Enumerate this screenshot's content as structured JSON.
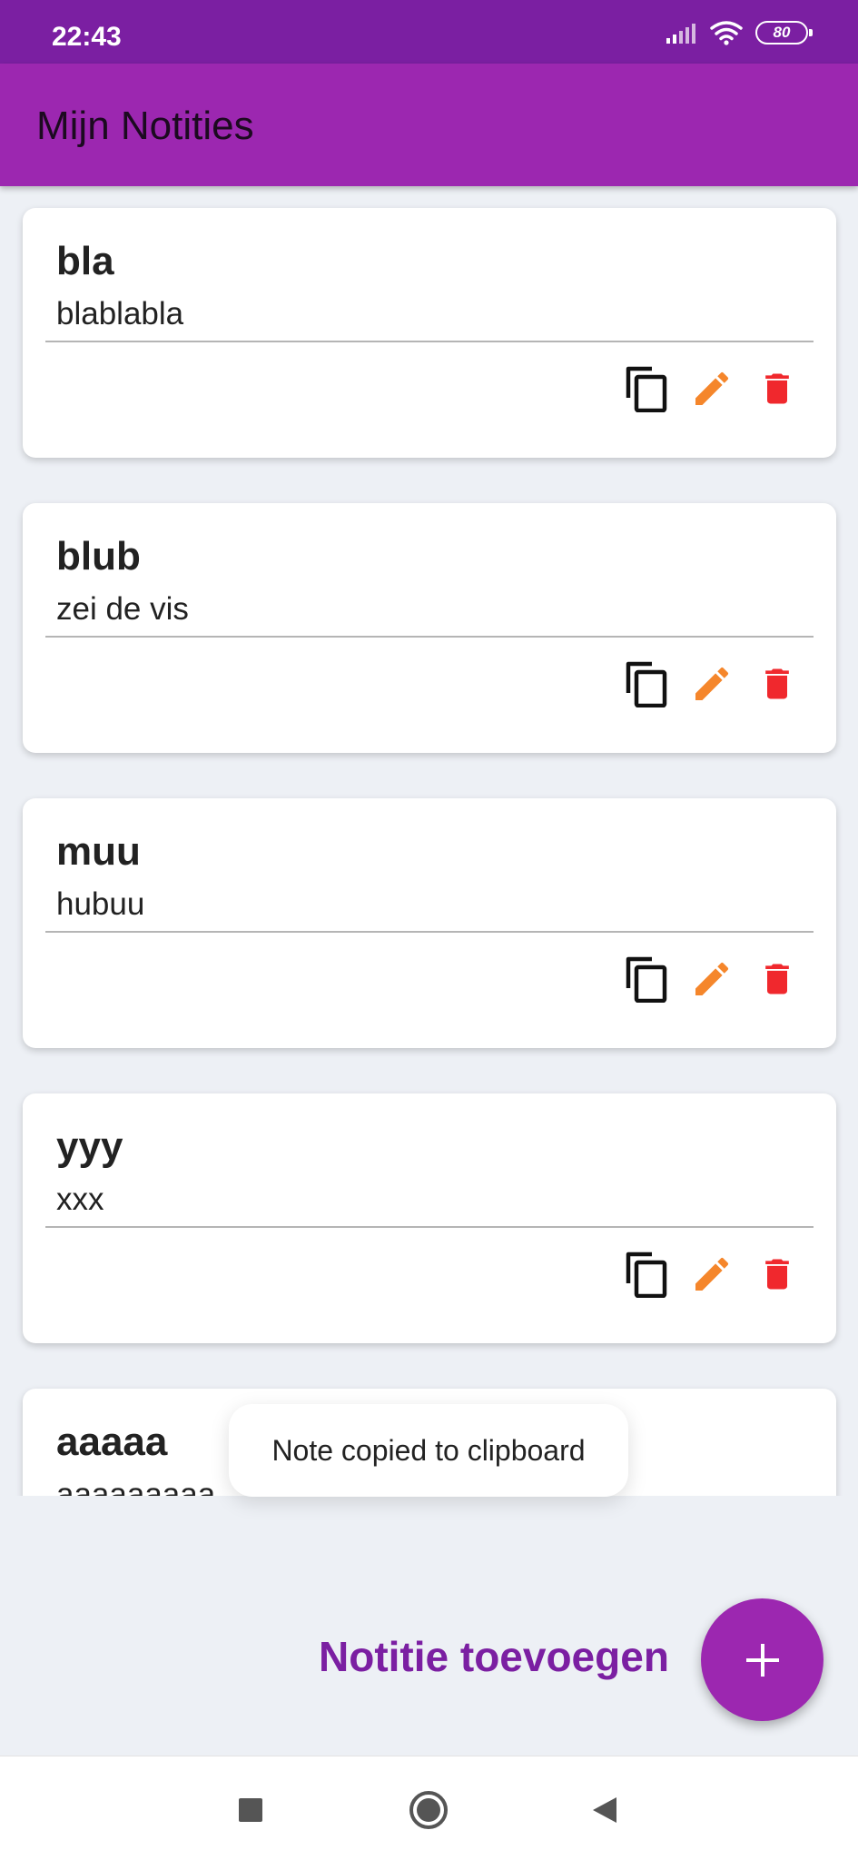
{
  "status_bar": {
    "time": "22:43",
    "battery": "80"
  },
  "app_bar": {
    "title": "Mijn Notities"
  },
  "notes": [
    {
      "title": "bla",
      "body": "blablabla"
    },
    {
      "title": "blub",
      "body": "zei de vis"
    },
    {
      "title": "muu",
      "body": "hubuu"
    },
    {
      "title": "yyy",
      "body": "xxx"
    },
    {
      "title": "aaaaa",
      "body": "aaaaaaaaa"
    }
  ],
  "actions": {
    "copy_icon": "copy-icon",
    "edit_icon": "pencil-icon",
    "delete_icon": "trash-icon"
  },
  "toast": {
    "message": "Note copied to clipboard"
  },
  "footer": {
    "add_label": "Notitie toevoegen",
    "fab_icon": "plus-icon"
  },
  "colors": {
    "primary": "#9c27b0",
    "primary_dark": "#7b1fa2",
    "edit": "#f5862b",
    "delete": "#f0282d",
    "background": "#edf0f5"
  }
}
